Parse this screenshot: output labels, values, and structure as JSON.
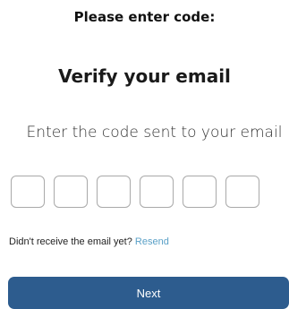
{
  "header": {
    "title": "Please enter code:"
  },
  "main": {
    "heading": "Verify your email",
    "subtitle": "Enter the code sent to your email",
    "code_fields": [
      {
        "value": ""
      },
      {
        "value": ""
      },
      {
        "value": ""
      },
      {
        "value": ""
      },
      {
        "value": ""
      },
      {
        "value": ""
      }
    ],
    "resend": {
      "prompt": "Didn't receive the email yet?",
      "link_label": "Resend"
    },
    "next_label": "Next"
  },
  "colors": {
    "button_background": "#2d5c8e",
    "link": "#5aa0c7",
    "field_border": "#a9a9a9"
  }
}
